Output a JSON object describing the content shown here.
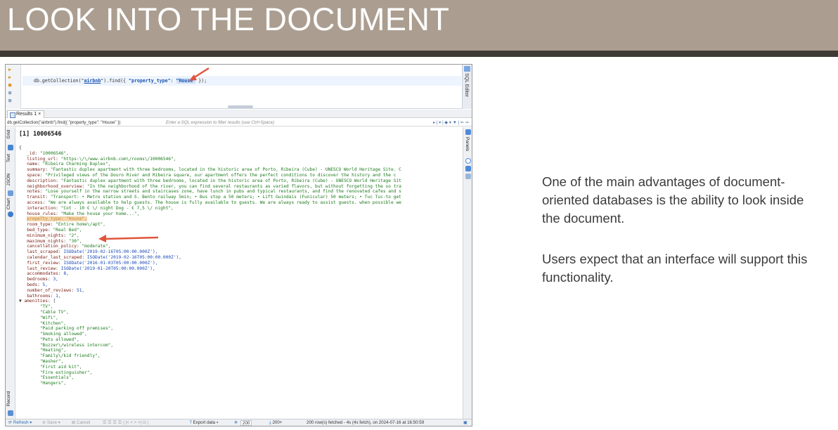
{
  "slide": {
    "title": "LOOK INTO THE DOCUMENT",
    "paragraph1": "One of the main advantages of document-oriented databases is the ability to look inside the document.",
    "paragraph2": "Users expect that an interface will support this functionality."
  },
  "editor": {
    "query_prefix": "db.getCollection(\"",
    "query_collection": "airbnb",
    "query_mid": "\").find({ ",
    "query_key": "\"property_type\"",
    "query_colon": ": ",
    "query_value": "\"House\"",
    "query_suffix": " });",
    "sql_editor_tab": "SQL Editor"
  },
  "results": {
    "tab_label": "Results 1 ×",
    "filter_query": "db.getCollection(\"airbnb\").find({ \"property_type\": \"House\" })",
    "filter_placeholder": "Enter a SQL expression to filter results (use Ctrl+Space)",
    "left_tabs": [
      "Grid",
      "Text",
      "JSON",
      "Chart",
      "Record"
    ],
    "right_tab": "Panels",
    "doc_title": "[1] 10006546"
  },
  "document": {
    "open_brace": "{",
    "fields": [
      {
        "key": "_id",
        "value": "\"10006546\","
      },
      {
        "key": "listing_url",
        "value": "\"https:\\/\\/www.airbnb.com\\/rooms\\/10006546\","
      },
      {
        "key": "name",
        "value": "\"Ribeira Charming Duplex\","
      },
      {
        "key": "summary",
        "value": "\"Fantastic duplex apartment with three bedrooms, located in the historic area of Porto, Ribeira (Cube) - UNESCO World Heritage Site. C"
      },
      {
        "key": "space",
        "value": "\"Privileged views of the Douro River and Ribeira square, our apartment offers the perfect conditions to discover the history and the c"
      },
      {
        "key": "description",
        "value": "\"Fantastic duplex apartment with three bedrooms, located in the historic area of Porto, Ribeira (Cube) - UNESCO World Heritage Sit"
      },
      {
        "key": "neighborhood_overview",
        "value": "\"In the neighborhood of the river, you can find several restaurants as varied flavors, but without forgetting the so tra"
      },
      {
        "key": "notes",
        "value": "\"Lose yourself in the narrow streets and staircases zone, have lunch in pubs and typical restaurants, and find the renovated cafes and s"
      },
      {
        "key": "transit",
        "value": "\"Transport: • Metro station and S. Bento railway 5min; • Bus stop a 50 meters; • Lift Guindais (Funicular) 50 meters; • Tuc Tuc-to get"
      },
      {
        "key": "access",
        "value": "\"We are always available to help guests. The house is fully available to guests. We are always ready to assist guests. when possible we"
      },
      {
        "key": "interaction",
        "value": "\"Cot - 10 € \\/ night Dog - € 7,5 \\/ night\","
      },
      {
        "key": "house_rules",
        "value": "\"Make the house your home...\","
      },
      {
        "key": "property_type",
        "value": "\"House\","
      },
      {
        "key": "room_type",
        "value": "\"Entire home\\/apt\","
      },
      {
        "key": "bed_type",
        "value": "\"Real Bed\","
      },
      {
        "key": "minimum_nights",
        "value": "\"2\","
      },
      {
        "key": "maximum_nights",
        "value": "\"30\","
      },
      {
        "key": "cancellation_policy",
        "value": "\"moderate\","
      },
      {
        "key": "last_scraped",
        "value": "ISODate('2019-02-16T05:00:00.000Z'),"
      },
      {
        "key": "calendar_last_scraped",
        "value": "ISODate('2019-02-16T05:00:00.000Z'),"
      },
      {
        "key": "first_review",
        "value": "ISODate('2016-01-03T05:00:00.000Z'),"
      },
      {
        "key": "last_review",
        "value": "ISODate('2019-01-20T05:00:00.000Z'),"
      },
      {
        "key": "accommodates",
        "value": "8,"
      },
      {
        "key": "bedrooms",
        "value": "3,"
      },
      {
        "key": "beds",
        "value": "5,"
      },
      {
        "key": "number_of_reviews",
        "value": "51,"
      },
      {
        "key": "bathrooms",
        "value": "1,"
      }
    ],
    "amenities_key": "amenities",
    "amenities_open": "[",
    "amenities": [
      "\"TV\",",
      "\"Cable TV\",",
      "\"Wifi\",",
      "\"Kitchen\",",
      "\"Paid parking off premises\",",
      "\"Smoking allowed\",",
      "\"Pets allowed\",",
      "\"Buzzer\\/wireless intercom\",",
      "\"Heating\",",
      "\"Family\\/kid friendly\",",
      "\"Washer\",",
      "\"First aid kit\",",
      "\"Fire extinguisher\",",
      "\"Essentials\",",
      "\"Hangers\","
    ]
  },
  "status_bar": {
    "refresh": "Refresh ▾",
    "save": "Save ▾",
    "cancel": "Cancel",
    "export": "Export data ▾",
    "page_size": "200",
    "total": "200+",
    "fetch_info": "200 row(s) fetched - 4s (4s fetch), on 2024-07-16 at 16:50:59"
  },
  "colors": {
    "header_bg": "#ab9e90",
    "header_bar": "#3f3a36",
    "arrow": "#e0553a",
    "key": "#7a1d12",
    "string": "#1c7a1c",
    "number": "#1747b5",
    "highlight": "#f3d6ad"
  }
}
